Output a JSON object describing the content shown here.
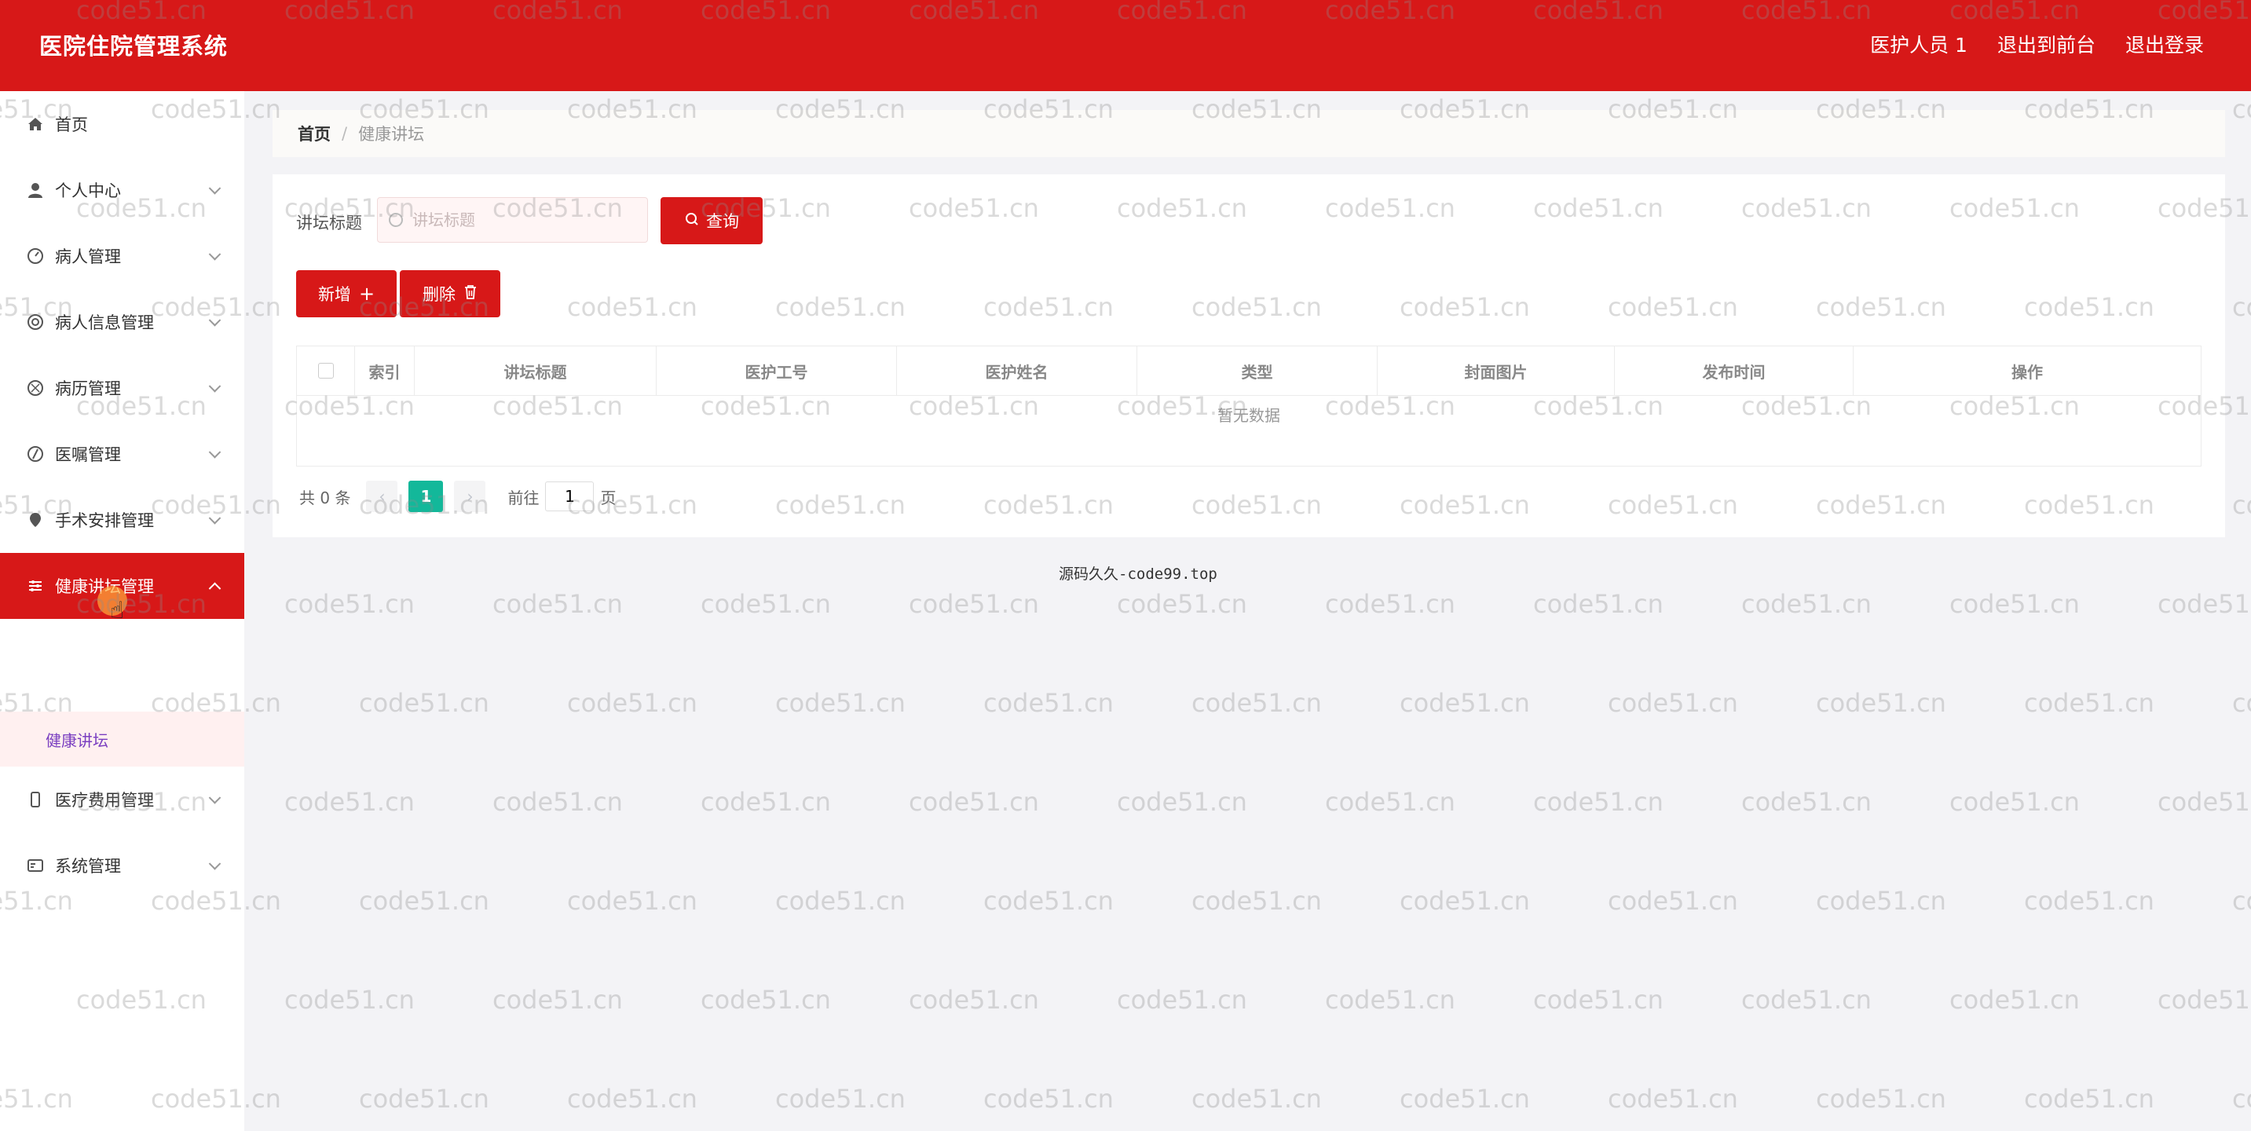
{
  "header": {
    "app_title": "医院住院管理系统",
    "user_label": "医护人员 1",
    "to_front_label": "退出到前台",
    "logout_label": "退出登录"
  },
  "sidebar": {
    "items": [
      {
        "label": "首页",
        "icon": "home-icon"
      },
      {
        "label": "个人中心",
        "icon": "user-icon"
      },
      {
        "label": "病人管理",
        "icon": "dashboard-icon"
      },
      {
        "label": "病人信息管理",
        "icon": "target-icon"
      },
      {
        "label": "病历管理",
        "icon": "aperture-icon"
      },
      {
        "label": "医嘱管理",
        "icon": "compass-icon"
      },
      {
        "label": "手术安排管理",
        "icon": "pin-icon"
      },
      {
        "label": "健康讲坛管理",
        "icon": "sliders-icon"
      },
      {
        "label": "医疗费用管理",
        "icon": "phone-icon"
      },
      {
        "label": "系统管理",
        "icon": "id-card-icon"
      }
    ],
    "sub_item": "健康讲坛"
  },
  "breadcrumb": {
    "home": "首页",
    "separator": "/",
    "current": "健康讲坛"
  },
  "search": {
    "label": "讲坛标题",
    "placeholder": "讲坛标题",
    "query_button": "查询"
  },
  "actions": {
    "add_label": "新增",
    "delete_label": "删除"
  },
  "table": {
    "columns": [
      "索引",
      "讲坛标题",
      "医护工号",
      "医护姓名",
      "类型",
      "封面图片",
      "发布时间",
      "操作"
    ],
    "empty_text": "暂无数据"
  },
  "pagination": {
    "total_text": "共 0 条",
    "current_page": "1",
    "goto_label": "前往",
    "goto_value": "1",
    "page_suffix": "页"
  },
  "footer_text": "源码久久-code99.top",
  "watermark": "code51.cn",
  "colors": {
    "primary": "#d71818",
    "page_active": "#13b89a",
    "submenu_text": "#7a3fc0"
  }
}
